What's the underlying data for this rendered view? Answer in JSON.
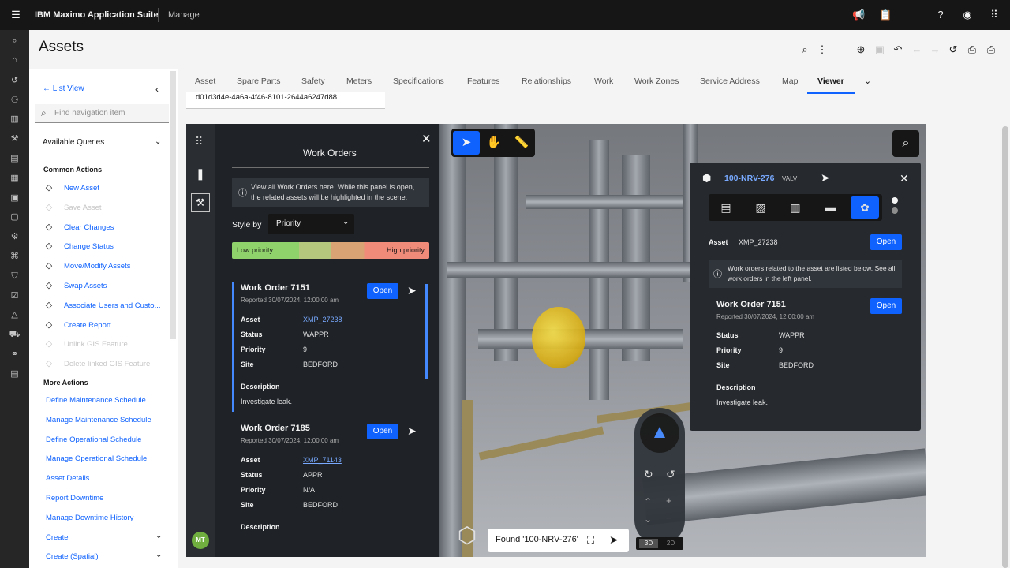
{
  "topbar": {
    "brand": "IBM Maximo Application Suite",
    "app": "Manage",
    "icons": [
      "menu-icon",
      "megaphone-icon",
      "clipboard-icon",
      "help-icon",
      "user-icon",
      "app-switcher-icon"
    ]
  },
  "page": {
    "title": "Assets"
  },
  "nav": {
    "list_view": "List View",
    "search_placeholder": "Find navigation item",
    "queries": "Available Queries",
    "common_actions_title": "Common Actions",
    "common_actions": [
      {
        "label": "New Asset",
        "enabled": true,
        "icon": "plus-icon"
      },
      {
        "label": "Save Asset",
        "enabled": false,
        "icon": "save-icon"
      },
      {
        "label": "Clear Changes",
        "enabled": true,
        "icon": "undo-icon"
      },
      {
        "label": "Change Status",
        "enabled": true,
        "icon": "status-icon"
      },
      {
        "label": "Move/Modify Assets",
        "enabled": true,
        "icon": "move-icon"
      },
      {
        "label": "Swap Assets",
        "enabled": true,
        "icon": "swap-icon"
      },
      {
        "label": "Associate Users and Custo...",
        "enabled": true,
        "icon": "users-icon"
      },
      {
        "label": "Create Report",
        "enabled": true,
        "icon": "report-icon"
      },
      {
        "label": "Unlink GIS Feature",
        "enabled": false,
        "icon": "unlink-icon"
      },
      {
        "label": "Delete linked GIS Feature",
        "enabled": false,
        "icon": "delete-icon"
      }
    ],
    "more_actions_title": "More Actions",
    "more_actions": [
      "Define Maintenance Schedule",
      "Manage Maintenance Schedule",
      "Define Operational Schedule",
      "Manage Operational Schedule",
      "Asset Details",
      "Report Downtime",
      "Manage Downtime History",
      "Create",
      "Create (Spatial)"
    ]
  },
  "tabs": [
    "Asset",
    "Spare Parts",
    "Safety",
    "Meters",
    "Specifications",
    "Features",
    "Relationships",
    "Work",
    "Work Zones",
    "Service Address",
    "Map",
    "Viewer"
  ],
  "active_tab": "Viewer",
  "guid": "d01d3d4e-4a6a-4f46-8101-2644a6247d88",
  "work_orders_panel": {
    "title": "Work Orders",
    "info": "View all Work Orders here. While this panel is open, the related assets will be highlighted in the scene.",
    "style_by_label": "Style by",
    "style_by_value": "Priority",
    "low_label": "Low priority",
    "high_label": "High priority",
    "avatar": "MT",
    "cards": [
      {
        "title": "Work Order 7151",
        "reported": "Reported 30/07/2024, 12:00:00 am",
        "open": "Open",
        "fields": {
          "Asset": "XMP_27238",
          "Status": "WAPPR",
          "Priority": "9",
          "Site": "BEDFORD"
        },
        "labels": {
          "asset": "Asset",
          "status": "Status",
          "priority": "Priority",
          "site": "Site",
          "description": "Description"
        },
        "description": "Investigate leak."
      },
      {
        "title": "Work Order 7185",
        "reported": "Reported 30/07/2024, 12:00:00 am",
        "open": "Open",
        "fields": {
          "Asset": "XMP_71143",
          "Status": "APPR",
          "Priority": "N/A",
          "Site": "BEDFORD"
        },
        "labels": {
          "asset": "Asset",
          "status": "Status",
          "priority": "Priority",
          "site": "Site",
          "description": "Description"
        },
        "description": ""
      }
    ]
  },
  "asset_popup": {
    "title": "100-NRV-276",
    "type": "VALV",
    "asset_label": "Asset",
    "asset_value": "XMP_27238",
    "open": "Open",
    "info": "Work orders related to the asset are listed below. See all work orders in the left panel.",
    "wo": {
      "title": "Work Order 7151",
      "reported": "Reported 30/07/2024, 12:00:00 am",
      "open": "Open",
      "status_label": "Status",
      "status": "WAPPR",
      "priority_label": "Priority",
      "priority": "9",
      "site_label": "Site",
      "site": "BEDFORD",
      "description_label": "Description",
      "description": "Investigate leak."
    }
  },
  "scene": {
    "found_text": "Found '100-NRV-276'",
    "mode_3d": "3D",
    "mode_2d": "2D"
  }
}
